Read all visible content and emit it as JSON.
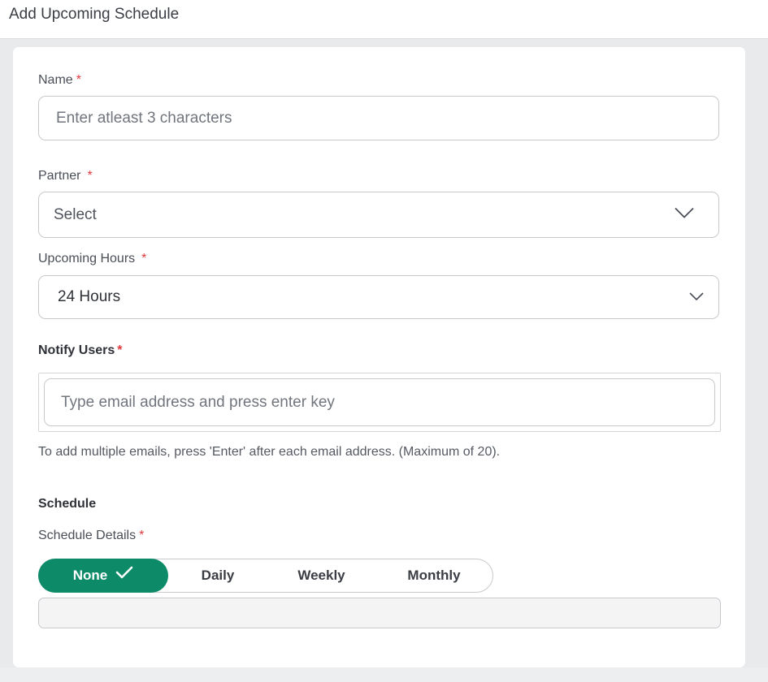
{
  "header": {
    "title": "Add Upcoming Schedule"
  },
  "form": {
    "name": {
      "label": "Name",
      "required_mark": "*",
      "placeholder": "Enter atleast 3 characters"
    },
    "partner": {
      "label": "Partner",
      "required_mark": "*",
      "value": "Select",
      "icon": "chevron-down-icon"
    },
    "upcoming_hours": {
      "label": "Upcoming Hours",
      "required_mark": "*",
      "value": "24 Hours",
      "icon": "chevron-down-icon"
    },
    "notify_users": {
      "label": "Notify Users",
      "required_mark": "*",
      "placeholder": "Type email address and press enter key",
      "helper": "To add multiple emails, press 'Enter' after each email address. (Maximum of 20)."
    },
    "schedule": {
      "heading": "Schedule",
      "details_label": "Schedule Details",
      "required_mark": "*",
      "options": [
        "None",
        "Daily",
        "Weekly",
        "Monthly"
      ],
      "selected": "None",
      "selected_icon": "check-icon"
    }
  },
  "colors": {
    "accent": "#0d8a68",
    "required": "#e0393e",
    "border": "#c7c9cd",
    "page_bg": "#e9eaec"
  }
}
